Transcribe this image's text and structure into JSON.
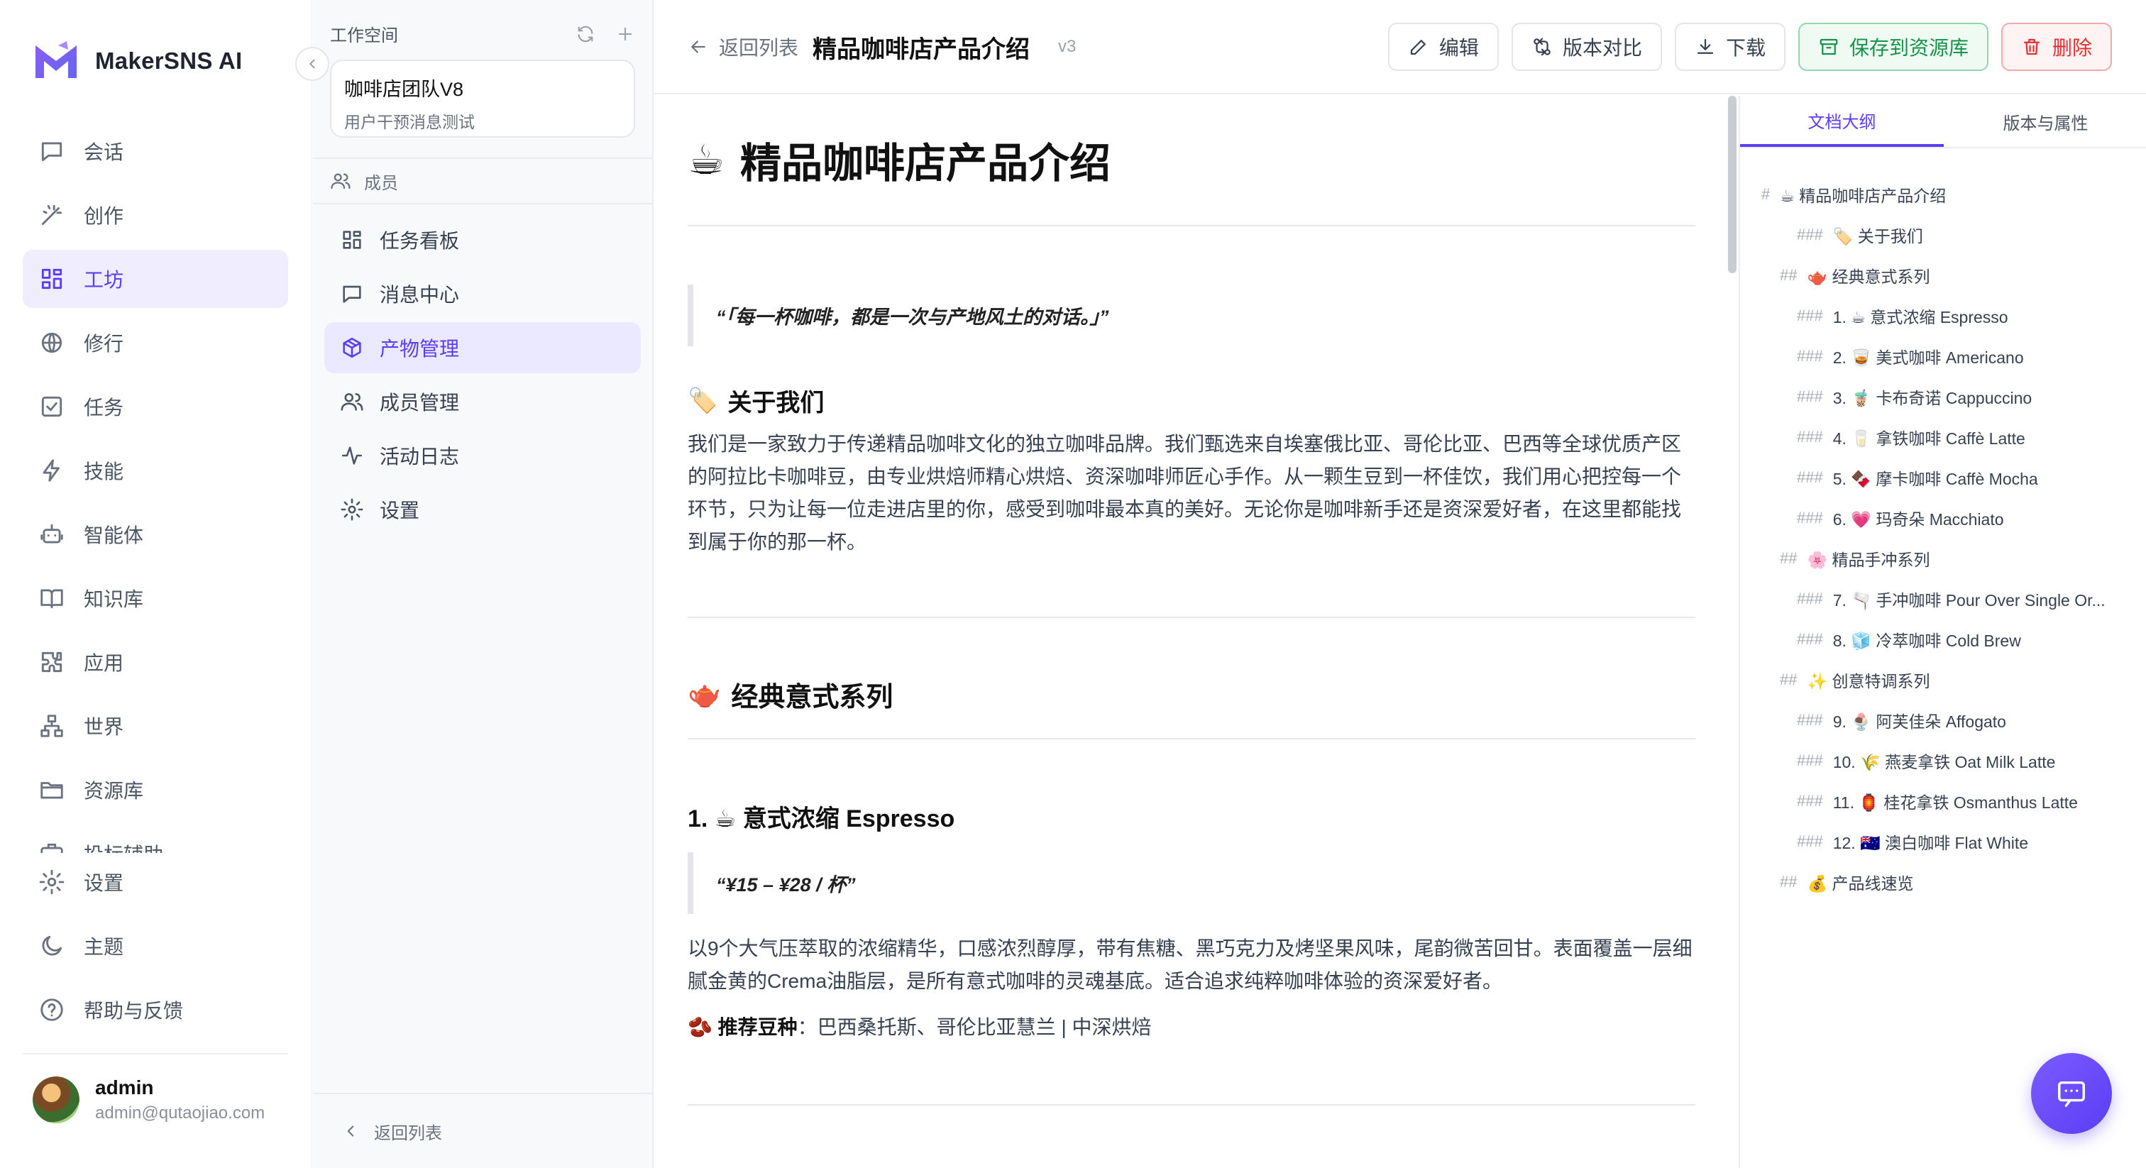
{
  "app": {
    "name": "MakerSNS AI"
  },
  "nav": {
    "items": [
      {
        "label": "会话",
        "icon": "chat-icon"
      },
      {
        "label": "创作",
        "icon": "magic-wand-icon"
      },
      {
        "label": "工坊",
        "icon": "grid-icon",
        "active": true
      },
      {
        "label": "修行",
        "icon": "globe-icon"
      },
      {
        "label": "任务",
        "icon": "check-square-icon"
      },
      {
        "label": "技能",
        "icon": "lightning-icon"
      },
      {
        "label": "智能体",
        "icon": "robot-icon"
      },
      {
        "label": "知识库",
        "icon": "book-icon"
      },
      {
        "label": "应用",
        "icon": "puzzle-icon"
      },
      {
        "label": "世界",
        "icon": "network-icon"
      },
      {
        "label": "资源库",
        "icon": "folder-icon"
      },
      {
        "label": "投标辅助",
        "icon": "briefcase-icon"
      }
    ],
    "bottom": [
      {
        "label": "设置",
        "icon": "gear-icon"
      },
      {
        "label": "主题",
        "icon": "moon-icon"
      },
      {
        "label": "帮助与反馈",
        "icon": "help-icon"
      }
    ],
    "user": {
      "name": "admin",
      "email": "admin@qutaojiao.com"
    }
  },
  "workspace": {
    "header": "工作空间",
    "card": {
      "title": "咖啡店团队V8",
      "subtitle": "用户干预消息测试"
    },
    "members_label": "成员",
    "menu": [
      {
        "label": "任务看板",
        "icon": "kanban-icon"
      },
      {
        "label": "消息中心",
        "icon": "message-icon"
      },
      {
        "label": "产物管理",
        "icon": "box-icon",
        "active": true
      },
      {
        "label": "成员管理",
        "icon": "users-icon"
      },
      {
        "label": "活动日志",
        "icon": "activity-icon"
      },
      {
        "label": "设置",
        "icon": "gear-icon"
      }
    ],
    "back_label": "返回列表"
  },
  "topbar": {
    "back_label": "返回列表",
    "title": "精品咖啡店产品介绍",
    "version": "v3",
    "buttons": {
      "edit": "编辑",
      "compare": "版本对比",
      "download": "下载",
      "save": "保存到资源库",
      "delete": "删除"
    }
  },
  "document": {
    "title_emoji": "☕",
    "title": "精品咖啡店产品介绍",
    "quote": "“「每一杯咖啡，都是一次与产地风土的对话。」”",
    "about": {
      "emoji": "🏷️",
      "heading": "关于我们",
      "body": "我们是一家致力于传递精品咖啡文化的独立咖啡品牌。我们甄选来自埃塞俄比亚、哥伦比亚、巴西等全球优质产区的阿拉比卡咖啡豆，由专业烘焙师精心烘焙、资深咖啡师匠心手作。从一颗生豆到一杯佳饮，我们用心把控每一个环节，只为让每一位走进店里的你，感受到咖啡最本真的美好。无论你是咖啡新手还是资深爱好者，在这里都能找到属于你的那一杯。"
    },
    "classic": {
      "emoji": "🫖",
      "heading": "经典意式系列"
    },
    "espresso": {
      "heading": "1. ☕ 意式浓缩 Espresso",
      "price": "“¥15 – ¥28 / 杯”",
      "body": "以9个大气压萃取的浓缩精华，口感浓烈醇厚，带有焦糖、黑巧克力及烤坚果风味，尾韵微苦回甘。表面覆盖一层细腻金黄的Crema油脂层，是所有意式咖啡的灵魂基底。适合追求纯粹咖啡体验的资深爱好者。",
      "bean_emoji": "🫘",
      "bean_label": "推荐豆种",
      "bean_value": "：巴西桑托斯、哥伦比亚慧兰 | 中深烘焙"
    }
  },
  "outline": {
    "tabs": [
      "文档大纲",
      "版本与属性"
    ],
    "items": [
      {
        "level": 1,
        "marker": "#",
        "text": "☕ 精品咖啡店产品介绍"
      },
      {
        "level": 3,
        "marker": "###",
        "text": "🏷️ 关于我们"
      },
      {
        "level": 2,
        "marker": "##",
        "text": "🫖 经典意式系列"
      },
      {
        "level": 3,
        "marker": "###",
        "text": "1. ☕ 意式浓缩 Espresso"
      },
      {
        "level": 3,
        "marker": "###",
        "text": "2. 🥃 美式咖啡 Americano"
      },
      {
        "level": 3,
        "marker": "###",
        "text": "3. 🧋 卡布奇诺 Cappuccino"
      },
      {
        "level": 3,
        "marker": "###",
        "text": "4. 🥛 拿铁咖啡 Caffè Latte"
      },
      {
        "level": 3,
        "marker": "###",
        "text": "5. 🍫 摩卡咖啡 Caffè Mocha"
      },
      {
        "level": 3,
        "marker": "###",
        "text": "6. 💗 玛奇朵 Macchiato"
      },
      {
        "level": 2,
        "marker": "##",
        "text": "🌸 精品手冲系列"
      },
      {
        "level": 3,
        "marker": "###",
        "text": "7. 🫗 手冲咖啡 Pour Over Single Or..."
      },
      {
        "level": 3,
        "marker": "###",
        "text": "8. 🧊 冷萃咖啡 Cold Brew"
      },
      {
        "level": 2,
        "marker": "##",
        "text": "✨ 创意特调系列"
      },
      {
        "level": 3,
        "marker": "###",
        "text": "9. 🍨 阿芙佳朵 Affogato"
      },
      {
        "level": 3,
        "marker": "###",
        "text": "10. 🌾 燕麦拿铁 Oat Milk Latte"
      },
      {
        "level": 3,
        "marker": "###",
        "text": "11. 🏮 桂花拿铁 Osmanthus Latte"
      },
      {
        "level": 3,
        "marker": "###",
        "text": "12. 🇦🇺 澳白咖啡 Flat White"
      },
      {
        "level": 2,
        "marker": "##",
        "text": "💰 产品线速览"
      }
    ]
  },
  "colors": {
    "accent": "#5b3df5",
    "save_green": "#16924a",
    "delete_red": "#e03131"
  }
}
